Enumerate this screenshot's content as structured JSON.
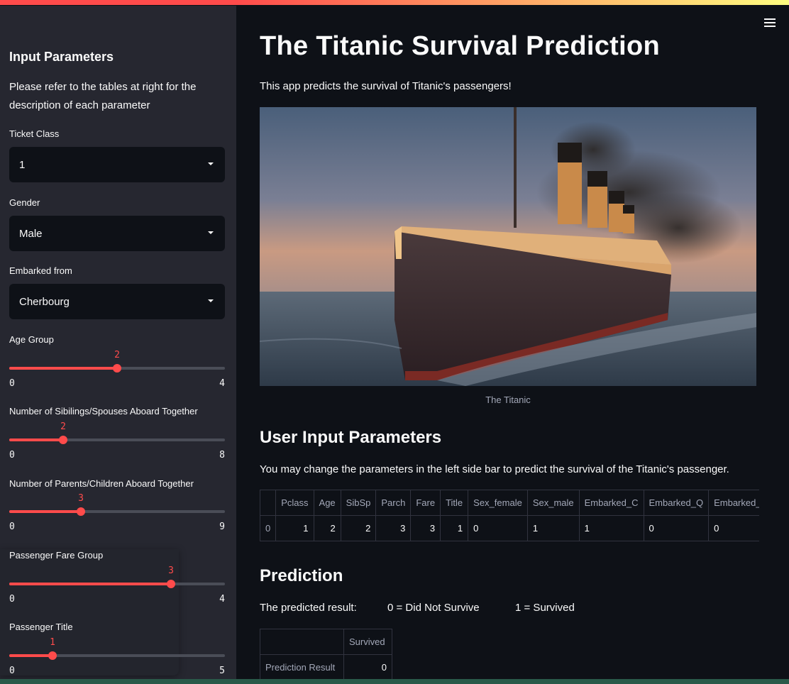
{
  "sidebar": {
    "title": "Input Parameters",
    "description": "Please refer to the tables at right for the description of each parameter",
    "selects": [
      {
        "label": "Ticket Class",
        "value": "1"
      },
      {
        "label": "Gender",
        "value": "Male"
      },
      {
        "label": "Embarked from",
        "value": "Cherbourg"
      }
    ],
    "sliders": [
      {
        "label": "Age Group",
        "value": 2,
        "min": 0,
        "max": 4,
        "value_text": "2",
        "min_text": "0",
        "max_text": "4"
      },
      {
        "label": "Number of Sibilings/Spouses Aboard Together",
        "value": 2,
        "min": 0,
        "max": 8,
        "value_text": "2",
        "min_text": "0",
        "max_text": "8"
      },
      {
        "label": "Number of Parents/Children Aboard Together",
        "value": 3,
        "min": 0,
        "max": 9,
        "value_text": "3",
        "min_text": "0",
        "max_text": "9"
      },
      {
        "label": "Passenger Fare Group",
        "value": 3,
        "min": 0,
        "max": 4,
        "value_text": "3",
        "min_text": "0",
        "max_text": "4"
      },
      {
        "label": "Passenger Title",
        "value": 1,
        "min": 0,
        "max": 5,
        "value_text": "1",
        "min_text": "0",
        "max_text": "5"
      }
    ],
    "accent_color": "#ff4b4b"
  },
  "main": {
    "title": "The Titanic Survival Prediction",
    "intro": "This app predicts the survival of Titanic's passengers!",
    "image_caption": "The Titanic",
    "user_input": {
      "heading": "User Input Parameters",
      "description": "You may change the parameters in the left side bar to predict the survival of the Titanic's passenger.",
      "columns": [
        "",
        "Pclass",
        "Age",
        "SibSp",
        "Parch",
        "Fare",
        "Title",
        "Sex_female",
        "Sex_male",
        "Embarked_C",
        "Embarked_Q",
        "Embarked_S"
      ],
      "row": [
        "0",
        "1",
        "2",
        "2",
        "3",
        "3",
        "1",
        "0",
        "1",
        "1",
        "0",
        "0"
      ]
    },
    "prediction": {
      "heading": "Prediction",
      "label": "The predicted result:",
      "legend_0": "0 = Did Not Survive",
      "legend_1": "1 = Survived",
      "table_header": "Survived",
      "row_label": "Prediction Result",
      "row_value": "0"
    }
  }
}
